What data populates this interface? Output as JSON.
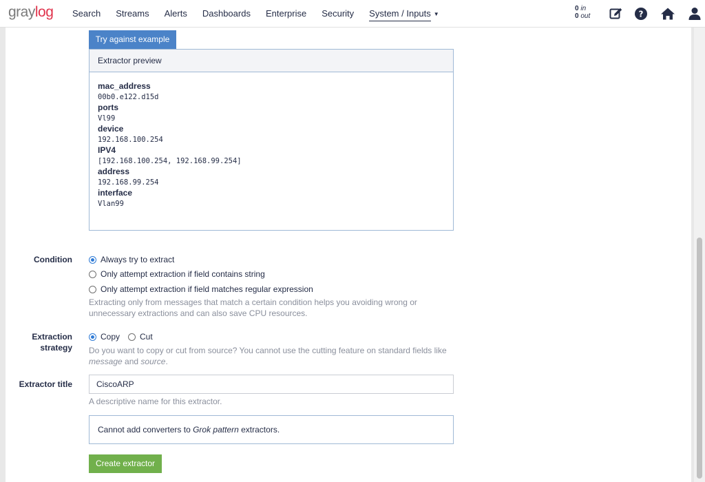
{
  "brand": {
    "prefix": "gray",
    "accent": "log"
  },
  "nav": {
    "items": [
      "Search",
      "Streams",
      "Alerts",
      "Dashboards",
      "Enterprise",
      "Security"
    ],
    "active": "System / Inputs"
  },
  "io": {
    "in_value": "0",
    "in_label": "in",
    "out_value": "0",
    "out_label": "out"
  },
  "icons": [
    "edit-icon",
    "help-icon",
    "home-icon",
    "user-icon"
  ],
  "try_button": "Try against example",
  "preview": {
    "title": "Extractor preview",
    "fields": [
      {
        "key": "mac_address",
        "value": "00b0.e122.d15d"
      },
      {
        "key": "ports",
        "value": "Vl99"
      },
      {
        "key": "device",
        "value": "192.168.100.254"
      },
      {
        "key": "IPV4",
        "value": "[192.168.100.254, 192.168.99.254]"
      },
      {
        "key": "address",
        "value": "192.168.99.254"
      },
      {
        "key": "interface",
        "value": "Vlan99"
      }
    ]
  },
  "condition": {
    "label": "Condition",
    "options": [
      "Always try to extract",
      "Only attempt extraction if field contains string",
      "Only attempt extraction if field matches regular expression"
    ],
    "selected": 0,
    "help_line1": "Extracting only from messages that match a certain condition helps you avoiding wrong or",
    "help_line2": "unnecessary extractions and can also save CPU resources."
  },
  "strategy": {
    "label_line1": "Extraction",
    "label_line2": "strategy",
    "options": [
      "Copy",
      "Cut"
    ],
    "selected": 0,
    "help_line1": "Do you want to copy or cut from source? You cannot use the cutting feature on standard fields like",
    "help_em1": "message",
    "help_and": " and ",
    "help_em2": "source",
    "help_end": "."
  },
  "title_field": {
    "label": "Extractor title",
    "value": "CiscoARP",
    "help": "A descriptive name for this extractor."
  },
  "converter_notice": {
    "before": "Cannot add converters to ",
    "em": "Grok pattern",
    "after": " extractors."
  },
  "create_button": "Create extractor",
  "colors": {
    "primary": "#4b83c8",
    "success": "#71b04c",
    "brand_accent": "#e0334c"
  }
}
